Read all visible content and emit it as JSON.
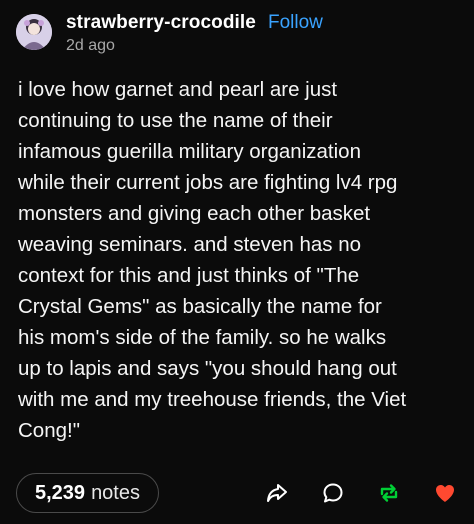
{
  "post": {
    "username": "strawberry-crocodile",
    "follow_label": "Follow",
    "timestamp": "2d ago",
    "body": "i love how garnet and pearl are just\ncontinuing to use the name of their\ninfamous guerilla military organization\nwhile their current jobs are fighting lv4 rpg\nmonsters and giving each other basket\nweaving seminars. and steven has no\ncontext for this and just thinks of \"The\nCrystal Gems\" as basically the name for\nhis mom's side of the family. so he walks\nup to lapis and says \"you should hang out\nwith me and my treehouse friends, the Viet\nCong!\""
  },
  "footer": {
    "notes_count": "5,239",
    "notes_label": "notes",
    "icons": [
      "share-icon",
      "reply-icon",
      "reblog-icon",
      "like-icon"
    ]
  },
  "colors": {
    "background": "#0b0b0b",
    "follow": "#3aa3ff",
    "reblog": "#00cf35",
    "like": "#ff4930",
    "muted": "#a8a8a8"
  }
}
